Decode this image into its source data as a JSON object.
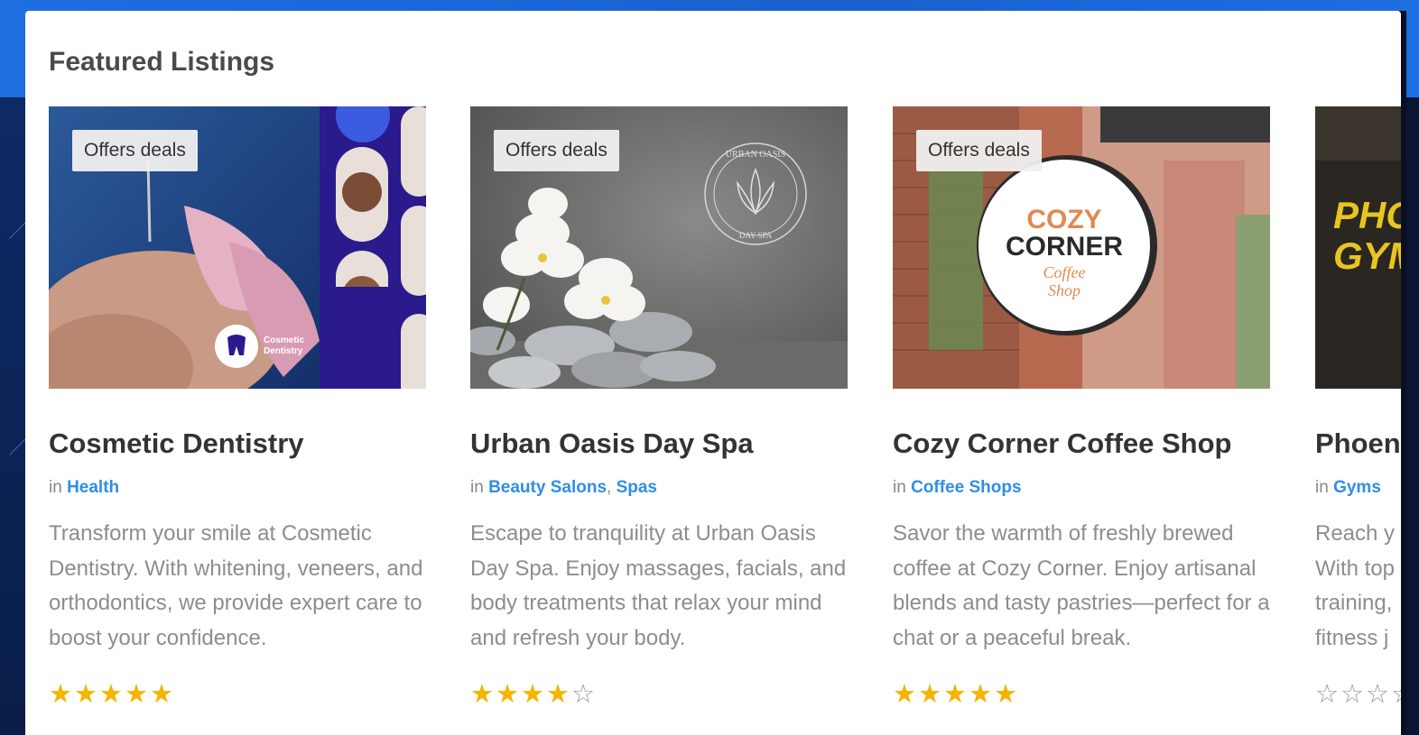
{
  "section": {
    "title": "Featured Listings"
  },
  "cards": [
    {
      "badge": "Offers deals",
      "title": "Cosmetic Dentistry",
      "category_prefix": "in ",
      "categories": [
        "Health"
      ],
      "description": "Transform your smile at Cosmetic Dentistry. With whitening, veneers, and orthodontics, we provide expert care to boost your confidence.",
      "rating": 5,
      "image": {
        "logo_line1": "Cosmetic",
        "logo_line2": "Dentistry"
      }
    },
    {
      "badge": "Offers deals",
      "title": "Urban Oasis Day Spa",
      "category_prefix": "in ",
      "categories": [
        "Beauty Salons",
        "Spas"
      ],
      "category_separator": ", ",
      "description": "Escape to tranquility at Urban Oasis Day Spa. Enjoy massages, facials, and body treatments that relax your mind and refresh your body.",
      "rating": 4,
      "image": {
        "logo_line1": "URBAN OASIS",
        "logo_line2": "DAY SPA"
      }
    },
    {
      "badge": "Offers deals",
      "title": "Cozy Corner Coffee Shop",
      "category_prefix": "in ",
      "categories": [
        "Coffee Shops"
      ],
      "description": "Savor the warmth of freshly brewed coffee at Cozy Corner. Enjoy artisanal blends and tasty pastries—perfect for a chat or a peaceful break.",
      "rating": 5,
      "image": {
        "sign_line1": "COZY",
        "sign_line2": "CORNER",
        "sign_line3": "Coffee",
        "sign_line4": "Shop"
      }
    },
    {
      "title": "Phoen",
      "category_prefix": "in ",
      "categories": [
        "Gyms"
      ],
      "description_lines": [
        "Reach y",
        "With top",
        "training,",
        "fitness j"
      ],
      "rating": 0,
      "image": {
        "text_line1": "PHOE",
        "text_line2": "GYM"
      }
    }
  ],
  "colors": {
    "frame_blue": "#1e6fe0",
    "star": "#f4b400",
    "link": "#2f8ee6",
    "title_text": "#333333"
  }
}
